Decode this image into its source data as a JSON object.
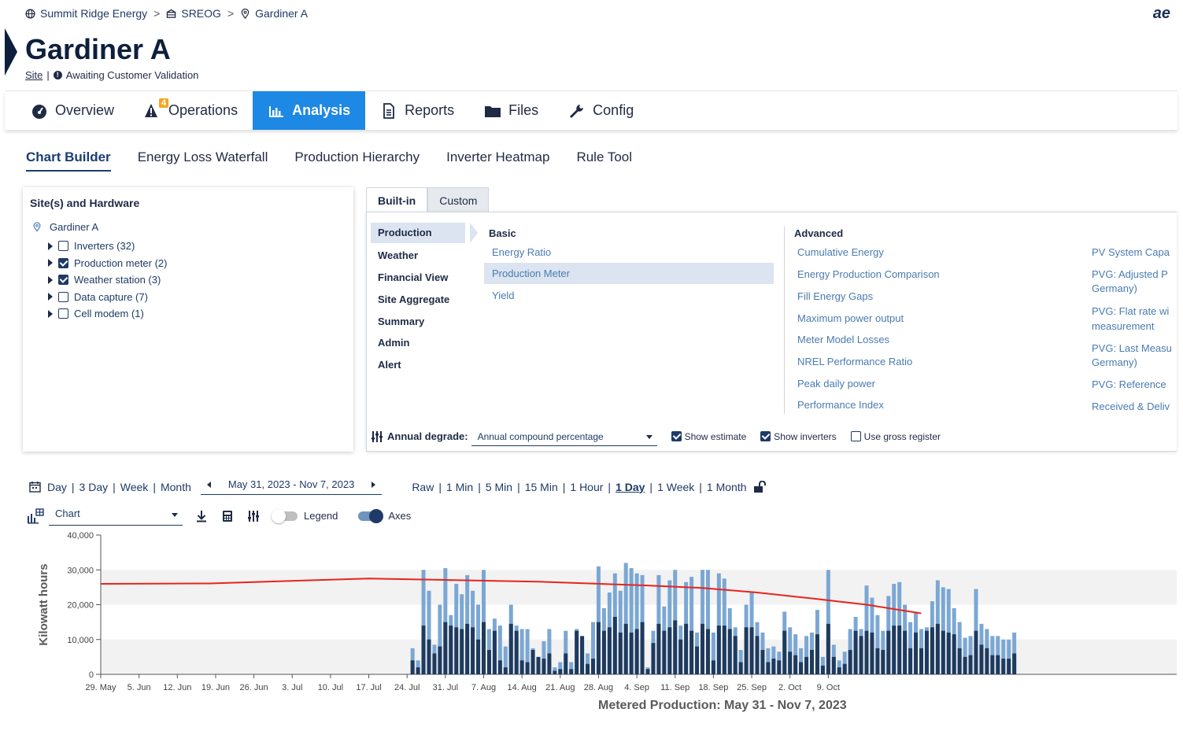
{
  "breadcrumb": {
    "company": "Summit Ridge Energy",
    "portfolio": "SREOG",
    "site": "Gardiner A",
    "sep": ">"
  },
  "logo": "ae",
  "page": {
    "title": "Gardiner A",
    "type": "Site",
    "status": "Awaiting Customer Validation"
  },
  "mainnav": {
    "overview": "Overview",
    "operations": "Operations",
    "operations_badge": "4",
    "analysis": "Analysis",
    "reports": "Reports",
    "files": "Files",
    "config": "Config"
  },
  "subtabs": [
    "Chart Builder",
    "Energy Loss Waterfall",
    "Production Hierarchy",
    "Inverter Heatmap",
    "Rule Tool"
  ],
  "sites_panel": {
    "title": "Site(s) and Hardware",
    "root": "Gardiner A",
    "items": [
      {
        "label": "Inverters (32)",
        "checked": false
      },
      {
        "label": "Production meter (2)",
        "checked": true
      },
      {
        "label": "Weather station (3)",
        "checked": true
      },
      {
        "label": "Data capture (7)",
        "checked": false
      },
      {
        "label": "Cell modem (1)",
        "checked": false
      }
    ]
  },
  "builder": {
    "tabs": [
      "Built-in",
      "Custom"
    ],
    "categories": [
      "Production",
      "Weather",
      "Financial View",
      "Site Aggregate",
      "Summary",
      "Admin",
      "Alert"
    ],
    "basic_head": "Basic",
    "basic": [
      "Energy Ratio",
      "Production Meter",
      "Yield"
    ],
    "advanced_head": "Advanced",
    "advanced": [
      "Cumulative Energy",
      "Energy Production Comparison",
      "Fill Energy Gaps",
      "Maximum power output",
      "Meter Model Losses",
      "NREL Performance Ratio",
      "Peak daily power",
      "Performance Index"
    ],
    "right": [
      "PV System Capa",
      "PVG: Adjusted P",
      "Germany)",
      "PVG: Flat rate wi",
      "measurement",
      "PVG: Last Measu",
      "Germany)",
      "PVG: Reference",
      "Received & Deliv"
    ],
    "annual_label": "Annual degrade:",
    "annual_value": "Annual compound percentage",
    "show_estimate": "Show estimate",
    "show_inverters": "Show inverters",
    "use_gross": "Use gross register"
  },
  "controls": {
    "ranges": [
      "Day",
      "3 Day",
      "Week",
      "Month"
    ],
    "date_range": "May 31, 2023 - Nov 7, 2023",
    "intervals": [
      "Raw",
      "1 Min",
      "5 Min",
      "15 Min",
      "1 Hour",
      "1 Day",
      "1 Week",
      "1 Month"
    ],
    "selected_interval": "1 Day",
    "chart_select": "Chart",
    "legend": "Legend",
    "legend_on": false,
    "axes": "Axes",
    "axes_on": true
  },
  "chart_data": {
    "type": "bar",
    "title": "Metered Production: May 31 - Nov 7, 2023",
    "ylabel": "Kilowatt hours",
    "ylim": [
      0,
      40000
    ],
    "yticks": [
      "0",
      "10,000",
      "20,000",
      "30,000",
      "40,000"
    ],
    "xticks": [
      "29. May",
      "5. Jun",
      "12. Jun",
      "19. Jun",
      "26. Jun",
      "3. Jul",
      "10. Jul",
      "17. Jul",
      "24. Jul",
      "31. Jul",
      "7. Aug",
      "14. Aug",
      "21. Aug",
      "28. Aug",
      "4. Sep",
      "11. Sep",
      "18. Sep",
      "25. Sep",
      "2. Oct",
      "9. Oct"
    ],
    "colors": {
      "light": "#7ba7d4",
      "dark": "#1e3a5f",
      "estimate": "#e8231f",
      "band": "#f2f2f2"
    },
    "bar_start_day": 57,
    "light_values": [
      7500,
      4000,
      30000,
      24000,
      8500,
      20000,
      30500,
      17000,
      26000,
      23000,
      28500,
      24000,
      20000,
      30000,
      13000,
      16000,
      14000,
      8000,
      20000,
      14000,
      13000,
      13000,
      7500,
      5000,
      9500,
      13000,
      2000,
      3500,
      12500,
      3500,
      13000,
      9500,
      6000,
      15000,
      31000,
      19000,
      23500,
      29000,
      24000,
      32000,
      30500,
      29000,
      28500,
      2000,
      12500,
      28500,
      19500,
      27000,
      30000,
      14000,
      26500,
      28000,
      12000,
      30000,
      30000,
      12000,
      29000,
      27500,
      19000,
      13500,
      7000,
      20000,
      23500,
      15000,
      12000,
      7500,
      8000,
      6500,
      18000,
      13500,
      11500,
      7500,
      11000,
      12000,
      18500,
      5000,
      30000,
      8500,
      4000,
      6500,
      13000,
      16500,
      13000,
      25500,
      22000,
      17000,
      12500,
      22500,
      26000,
      26500,
      20000,
      15000,
      18000,
      13000,
      13500,
      21000,
      27000,
      25000,
      24500,
      19000,
      15000,
      10500,
      11000,
      24500,
      14500,
      13000,
      11000,
      11000,
      10000,
      10000,
      12000
    ],
    "dark_values": [
      4000,
      2000,
      14000,
      10000,
      6000,
      8000,
      15000,
      14000,
      13500,
      13000,
      14500,
      13500,
      10000,
      15000,
      7000,
      12500,
      4000,
      2000,
      14500,
      12500,
      4000,
      3500,
      7000,
      5000,
      4500,
      6000,
      1000,
      1500,
      6000,
      1500,
      12500,
      11000,
      3000,
      4500,
      15000,
      12500,
      13500,
      16500,
      12000,
      14500,
      12000,
      13000,
      15000,
      1500,
      9000,
      14500,
      12500,
      13500,
      15500,
      10000,
      14500,
      12500,
      8000,
      14500,
      13000,
      4000,
      14000,
      14000,
      13000,
      11000,
      3500,
      13500,
      13500,
      11000,
      7000,
      3500,
      4500,
      4000,
      12500,
      6500,
      5500,
      3500,
      5000,
      7000,
      11500,
      2500,
      14500,
      5000,
      2000,
      3000,
      7000,
      12500,
      11000,
      12500,
      12000,
      7500,
      7000,
      12500,
      14000,
      14000,
      12500,
      7500,
      12000,
      7500,
      12500,
      13500,
      14500,
      12500,
      12000,
      11500,
      7500,
      5000,
      5500,
      12500,
      8500,
      7500,
      5500,
      5500,
      4500,
      4500,
      6000
    ],
    "estimate_series": [
      [
        0,
        26000
      ],
      [
        20,
        26100
      ],
      [
        40,
        27100
      ],
      [
        49,
        27500
      ],
      [
        60,
        27200
      ],
      [
        80,
        26600
      ],
      [
        100,
        25500
      ],
      [
        110,
        24800
      ],
      [
        120,
        23500
      ],
      [
        130,
        21800
      ],
      [
        140,
        20000
      ],
      [
        150,
        17500
      ]
    ]
  }
}
